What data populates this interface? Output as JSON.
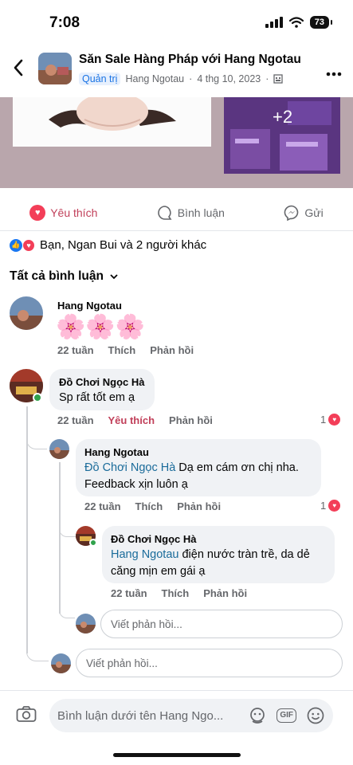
{
  "status": {
    "time": "7:08",
    "battery": "73"
  },
  "header": {
    "group_name": "Săn Sale Hàng Pháp với Hang Ngotau",
    "role_badge": "Quản trị",
    "author": "Hang Ngotau",
    "date": "4 thg 10, 2023",
    "separator": "·"
  },
  "post": {
    "more_photos": "+2"
  },
  "actions": {
    "like": "Yêu thích",
    "comment": "Bình luận",
    "share": "Gửi"
  },
  "reactions_summary": "Bạn, Ngan Bui và 2 người khác",
  "comments_filter": "Tất cả bình luận",
  "comments": [
    {
      "author": "Hang Ngotau",
      "text": "🌸🌸🌸",
      "time": "22 tuần",
      "like": "Thích",
      "reply": "Phản hồi"
    },
    {
      "author": "Đồ Chơi Ngọc Hà",
      "text": "Sp rất tốt em ạ",
      "time": "22 tuần",
      "like": "Yêu thích",
      "reply": "Phản hồi",
      "reaction_count": "1"
    }
  ],
  "replies": [
    {
      "author": "Hang Ngotau",
      "tag": "Đồ Chơi Ngọc Hà",
      "text_line1": " Dạ em cám ơn chị nha.",
      "text_line2": "Feedback xịn luôn ạ",
      "time": "22 tuần",
      "like": "Thích",
      "reply": "Phản hồi",
      "reaction_count": "1"
    },
    {
      "author": "Đồ Chơi Ngọc Hà",
      "tag": "Hang Ngotau",
      "text_line1": " điện nước tràn trề, da dẻ",
      "text_line2": "căng mịn em gái ạ",
      "time": "22 tuần",
      "like": "Thích",
      "reply": "Phản hồi"
    }
  ],
  "reply_placeholder": "Viết phản hồi...",
  "composer_placeholder": "Bình luận dưới tên Hang Ngo...",
  "composer_gif": "GIF",
  "colors": {
    "accent": "#1b74e4",
    "love": "#f33e58",
    "liked_text": "#c1405a",
    "bubble": "#f0f2f5"
  }
}
